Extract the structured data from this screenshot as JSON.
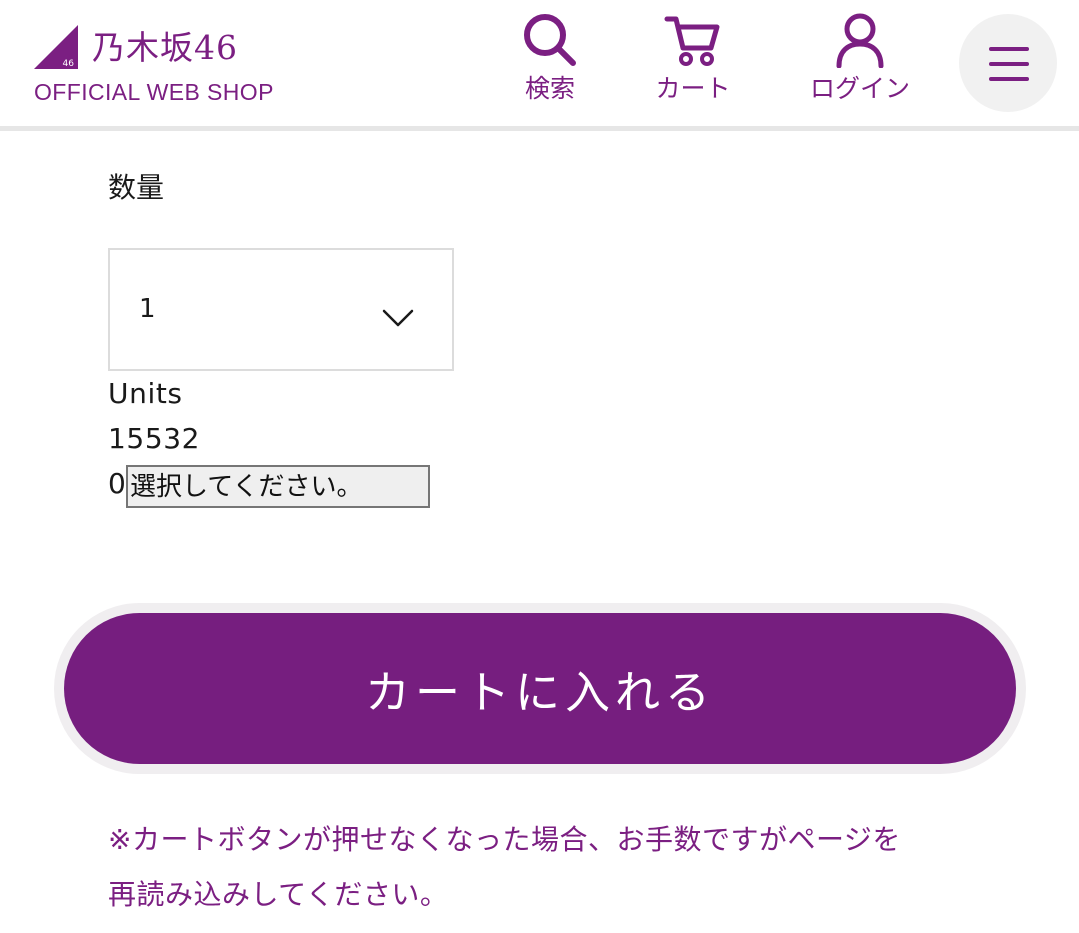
{
  "header": {
    "logo_name": "乃木坂46",
    "logo_mark_text": "46",
    "logo_sub": "OFFICIAL WEB SHOP",
    "nav": {
      "search_label": "検索",
      "cart_label": "カート",
      "login_label": "ログイン"
    },
    "menu_icon": "hamburger-icon",
    "brand_color": "#7b1f82"
  },
  "quantity": {
    "heading": "数量",
    "selected_value": "1",
    "units_label": "Units",
    "code": "15532",
    "zero": "0",
    "native_select_text": "選択してください。"
  },
  "cart_button": {
    "label": "カートに入れる",
    "color": "#761e7f"
  },
  "note": {
    "line1": "※カートボタンが押せなくなった場合、お手数ですがページを",
    "line2": "再読み込みしてください。"
  }
}
